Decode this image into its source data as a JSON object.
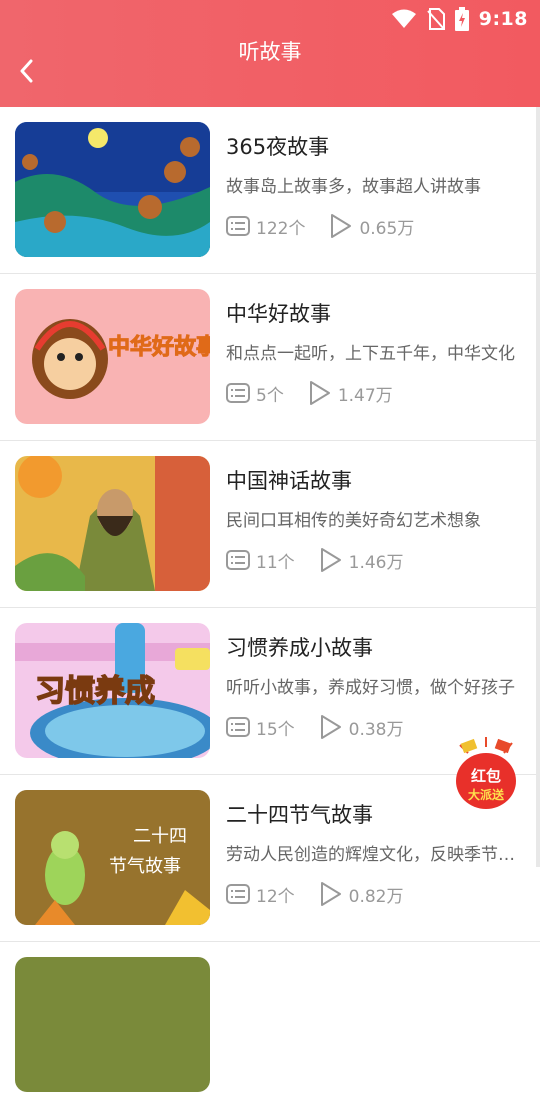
{
  "status_bar": {
    "time": "9:18"
  },
  "header": {
    "title": "听故事"
  },
  "stories": [
    {
      "title": "365夜故事",
      "desc": "故事岛上故事多，故事超人讲故事",
      "count": "122个",
      "plays": "0.65万",
      "thumb_icon": "monkeys-night-scene"
    },
    {
      "title": "中华好故事",
      "desc": "和点点一起听，上下五千年，中华文化",
      "count": "5个",
      "plays": "1.47万",
      "thumb_icon": "monkey-headphones",
      "thumb_text": "中华好故事"
    },
    {
      "title": "中国神话故事",
      "desc": "民间口耳相传的美好奇幻艺术想象",
      "count": "11个",
      "plays": "1.46万",
      "thumb_icon": "mythic-god-figure"
    },
    {
      "title": "习惯养成小故事",
      "desc": "听听小故事，养成好习惯，做个好孩子",
      "count": "15个",
      "plays": "0.38万",
      "thumb_icon": "bathtub-soap",
      "thumb_text": "习惯养成"
    },
    {
      "title": "二十四节气故事",
      "desc": "劳动人民创造的辉煌文化，反映季节变化",
      "count": "12个",
      "plays": "0.82万",
      "thumb_icon": "cicada-leaves",
      "thumb_text": "二十四节气故事"
    }
  ],
  "floating": {
    "red_packet_text": "红包大派送"
  },
  "colors": {
    "header": "#f25a60",
    "text_primary": "#222222",
    "text_secondary": "#666666",
    "text_meta": "#999999"
  }
}
